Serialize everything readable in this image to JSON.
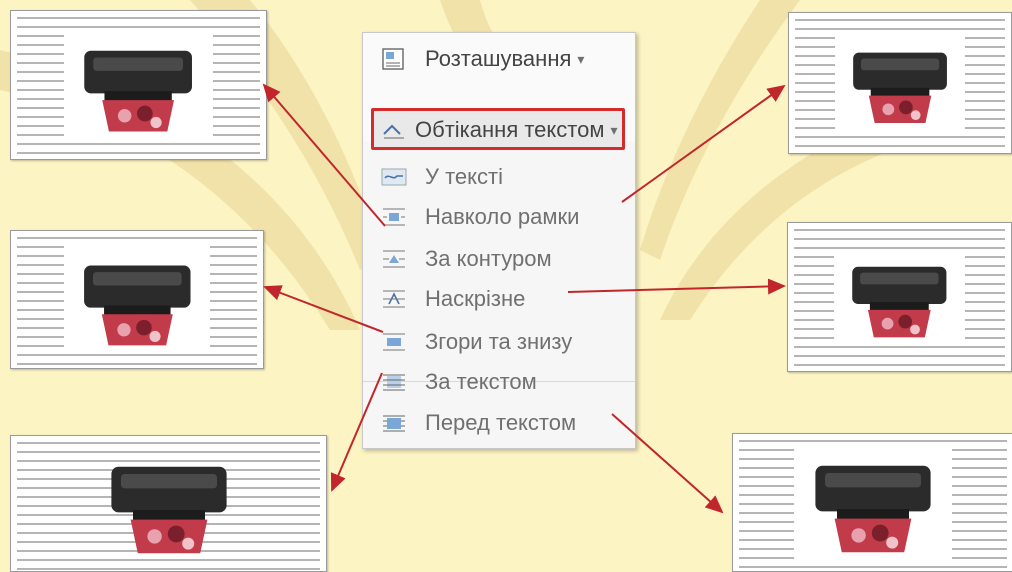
{
  "menu": {
    "items": [
      {
        "label": "Розташування",
        "suffix": "▾",
        "icon": "layout-icon"
      },
      {
        "label": "Обтікання текстом",
        "suffix": "▾",
        "icon": "wrap-text-icon"
      },
      {
        "label": "У тексті",
        "icon": "in-line-icon"
      },
      {
        "label": "Навколо рамки",
        "icon": "square-wrap-icon"
      },
      {
        "label": "За контуром",
        "icon": "tight-wrap-icon"
      },
      {
        "label": "Наскрізне",
        "icon": "through-wrap-icon"
      },
      {
        "label": "Згори та знизу",
        "icon": "top-bottom-wrap-icon"
      },
      {
        "label": "За текстом",
        "icon": "behind-text-icon"
      },
      {
        "label": "Перед текстом",
        "icon": "in-front-text-icon"
      }
    ]
  },
  "colors": {
    "background": "#fdf4c4",
    "highlight_border": "#d62b2b",
    "arrow": "#c0262b"
  }
}
